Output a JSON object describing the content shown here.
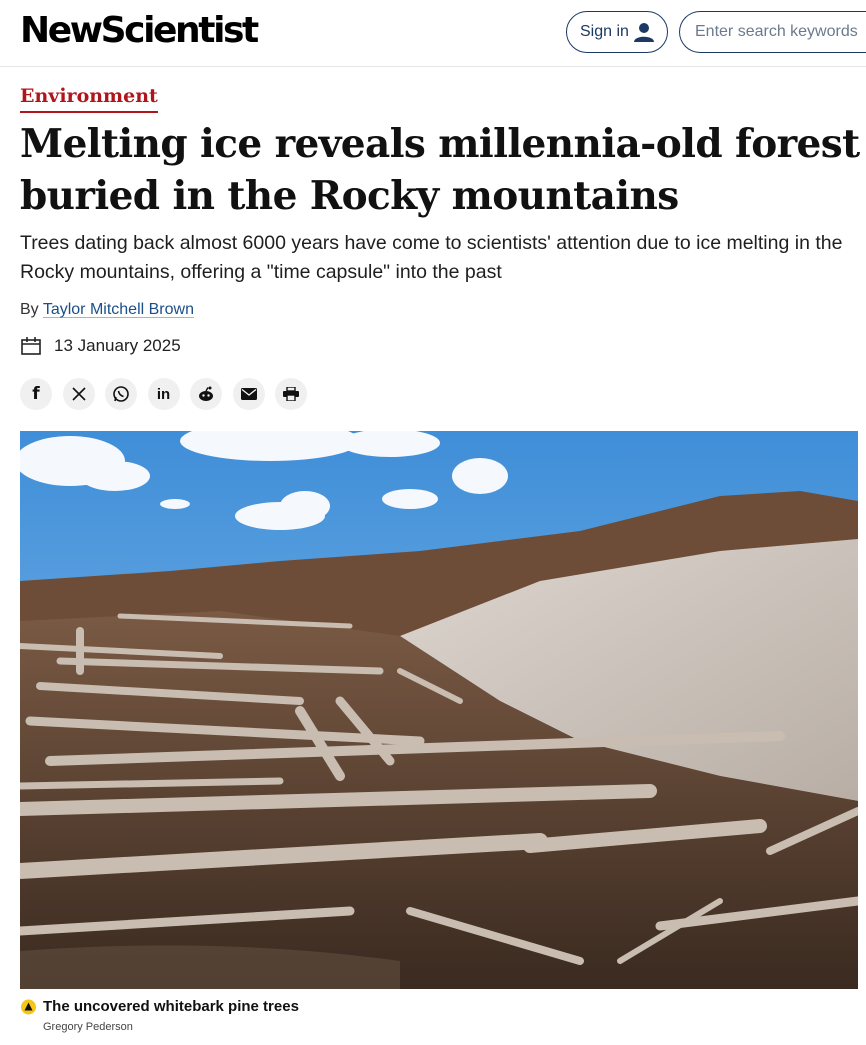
{
  "site": {
    "logo": "NewScientist"
  },
  "header": {
    "signin_label": "Sign in",
    "search_placeholder": "Enter search keywords"
  },
  "article": {
    "category": "Environment",
    "title": "Melting ice reveals millennia-old forest buried in the Rocky mountains",
    "standfirst": "Trees dating back almost 6000 years have come to scientists' attention due to ice melting in the Rocky mountains, offering a \"time capsule\" into the past",
    "byline_prefix": "By",
    "author": "Taylor Mitchell Brown",
    "date": "13 January 2025"
  },
  "share": [
    {
      "icon": "facebook-icon",
      "glyph": "f"
    },
    {
      "icon": "x-icon",
      "glyph": "𝕏"
    },
    {
      "icon": "whatsapp-icon",
      "glyph": ""
    },
    {
      "icon": "linkedin-icon",
      "glyph": "in"
    },
    {
      "icon": "reddit-icon",
      "glyph": ""
    },
    {
      "icon": "email-icon",
      "glyph": ""
    },
    {
      "icon": "print-icon",
      "glyph": ""
    }
  ],
  "image": {
    "caption": "The uncovered whitebark pine trees",
    "credit": "Gregory Pederson"
  },
  "colors": {
    "accent": "#b0151b",
    "link": "#1b4f8a",
    "nav_border": "#1b3a63",
    "caption_marker": "#f5c518"
  }
}
